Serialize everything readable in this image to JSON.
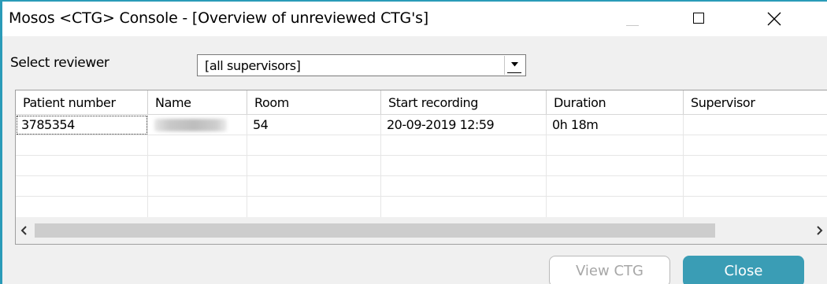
{
  "window": {
    "title": "Mosos <CTG> Console - [Overview of unreviewed CTG's]",
    "accent_color": "#2a9bb8"
  },
  "reviewer": {
    "label": "Select reviewer",
    "selected": "[all supervisors]"
  },
  "table": {
    "columns": [
      "Patient number",
      "Name",
      "Room",
      "Start recording",
      "Duration",
      "Supervisor"
    ],
    "rows": [
      {
        "patient_number": "3785354",
        "name": "",
        "room": "54",
        "start_recording": "20-09-2019 12:59",
        "duration": "0h 18m",
        "supervisor": ""
      }
    ]
  },
  "buttons": {
    "view_ctg": "View CTG",
    "close": "Close",
    "close_color": "#3a9db5"
  },
  "icons": [
    "minimize-icon",
    "maximize-icon",
    "close-icon",
    "chevron-down-icon",
    "scroll-left-icon",
    "scroll-right-icon"
  ]
}
